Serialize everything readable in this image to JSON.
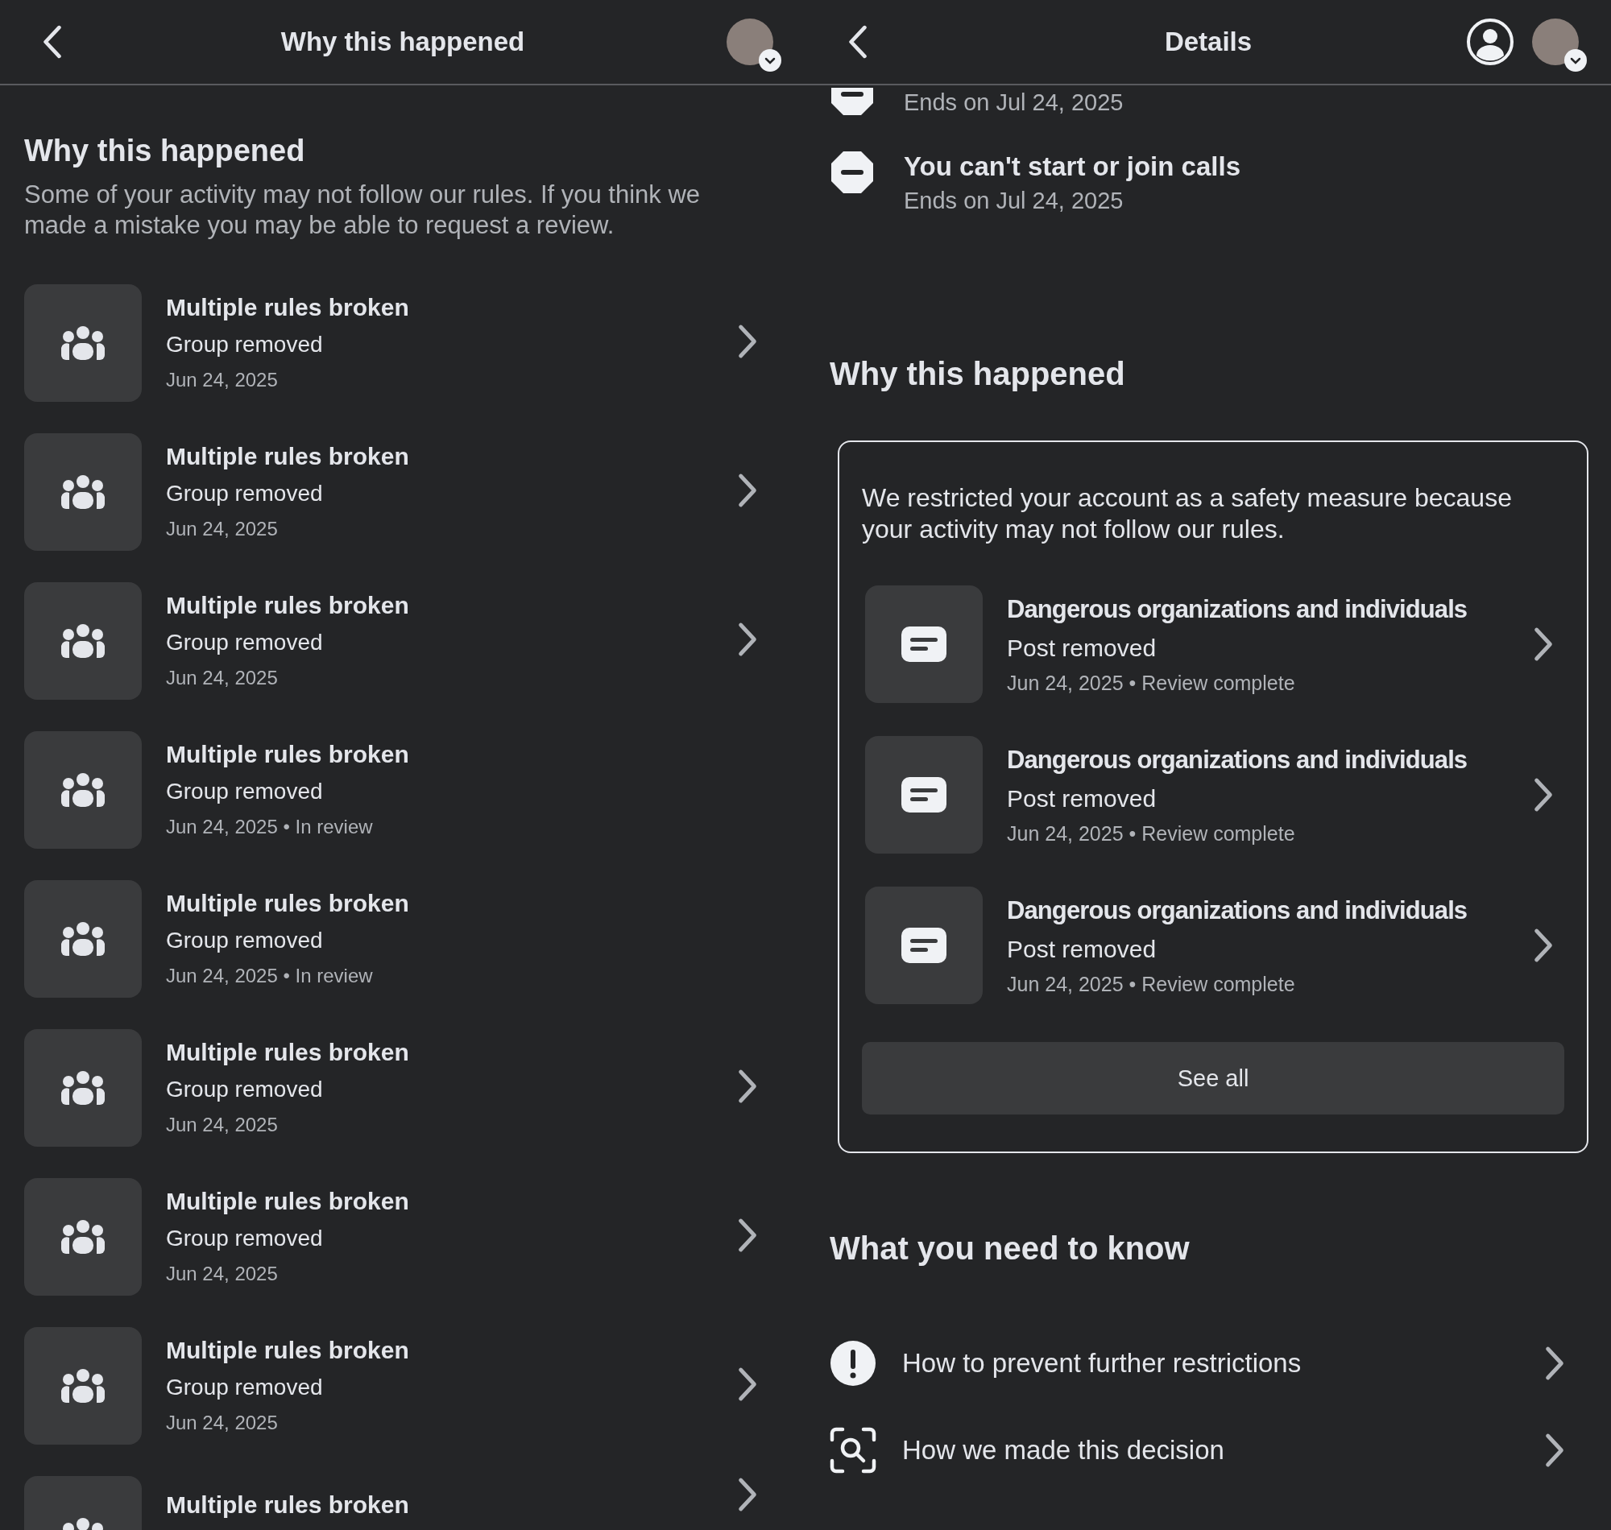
{
  "left": {
    "header": {
      "title": "Why this happened"
    },
    "heading": "Why this happened",
    "description": "Some of your activity may not follow our rules. If you think we made a mistake you may be able to request a review.",
    "items": [
      {
        "title": "Multiple rules broken",
        "subtitle": "Group removed",
        "meta": "Jun 24, 2025",
        "chevron": true
      },
      {
        "title": "Multiple rules broken",
        "subtitle": "Group removed",
        "meta": "Jun 24, 2025",
        "chevron": true
      },
      {
        "title": "Multiple rules broken",
        "subtitle": "Group removed",
        "meta": "Jun 24, 2025",
        "chevron": true
      },
      {
        "title": "Multiple rules broken",
        "subtitle": "Group removed",
        "meta": "Jun 24, 2025 • In review",
        "chevron": false
      },
      {
        "title": "Multiple rules broken",
        "subtitle": "Group removed",
        "meta": "Jun 24, 2025 • In review",
        "chevron": false
      },
      {
        "title": "Multiple rules broken",
        "subtitle": "Group removed",
        "meta": "Jun 24, 2025",
        "chevron": true
      },
      {
        "title": "Multiple rules broken",
        "subtitle": "Group removed",
        "meta": "Jun 24, 2025",
        "chevron": true
      },
      {
        "title": "Multiple rules broken",
        "subtitle": "Group removed",
        "meta": "Jun 24, 2025",
        "chevron": true
      },
      {
        "title": "Multiple rules broken",
        "chevron": true
      }
    ]
  },
  "right": {
    "header": {
      "title": "Details"
    },
    "restrictions": [
      {
        "ends": "Ends on Jul 24, 2025"
      },
      {
        "title": "You can't start or join calls",
        "ends": "Ends on Jul 24, 2025"
      }
    ],
    "why": {
      "heading": "Why this happened",
      "text": "We restricted your account as a safety measure because your activity may not follow our rules.",
      "items": [
        {
          "title": "Dangerous organizations and individuals",
          "subtitle": "Post removed",
          "meta": "Jun 24, 2025 • Review complete"
        },
        {
          "title": "Dangerous organizations and individuals",
          "subtitle": "Post removed",
          "meta": "Jun 24, 2025 • Review complete"
        },
        {
          "title": "Dangerous organizations and individuals",
          "subtitle": "Post removed",
          "meta": "Jun 24, 2025 • Review complete"
        }
      ],
      "button": "See all"
    },
    "know": {
      "heading": "What you need to know",
      "links": [
        {
          "kind": "alert",
          "label": "How to prevent further restrictions"
        },
        {
          "kind": "search",
          "label": "How we made this decision"
        }
      ]
    }
  }
}
